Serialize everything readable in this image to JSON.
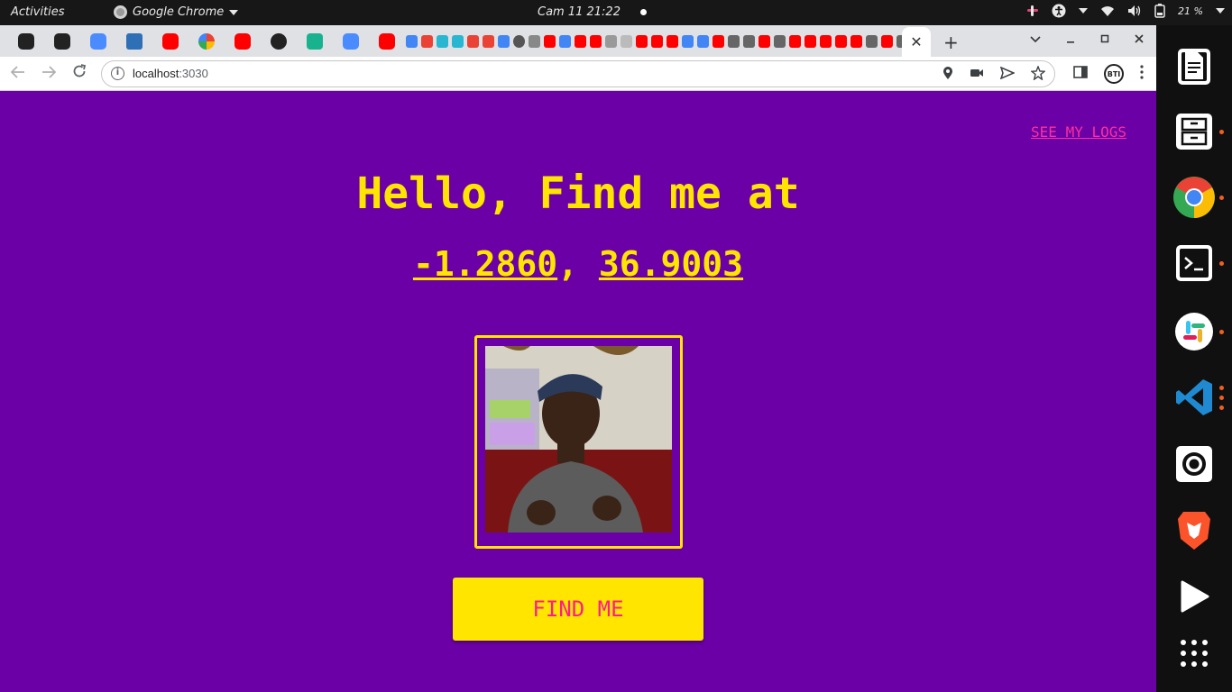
{
  "topbar": {
    "activities": "Activities",
    "app_name": "Google Chrome",
    "clock": "Cam 11  21:22",
    "battery": "21 %"
  },
  "browser": {
    "url_host": "localhost",
    "url_port": ":3030",
    "active_tab_close": "✕",
    "new_tab": "+",
    "profile_badge": "BTI"
  },
  "page": {
    "logs_link": "SEE MY LOGS",
    "greeting": "Hello, Find me at",
    "latitude": "-1.2860",
    "separator": ",",
    "longitude": "36.9003",
    "button": "FIND ME"
  },
  "colors": {
    "background": "#6b00a6",
    "accent_yellow": "#ffe500",
    "accent_pink": "#ff1c8d"
  },
  "icons": {
    "tabs": [
      "generic-hex-icon",
      "generic-hex-icon",
      "zoom-icon",
      "network-icon",
      "youtube-icon",
      "google-icon",
      "youtube-icon",
      "github-icon",
      "replit-icon",
      "zoom-icon",
      "youtube-icon"
    ],
    "dock": [
      "text-editor-icon",
      "file-cabinet-icon",
      "chrome-icon",
      "terminal-icon",
      "slack-icon",
      "vscode-icon",
      "obs-icon",
      "brave-icon",
      "play-icon",
      "app-grid-icon"
    ]
  }
}
